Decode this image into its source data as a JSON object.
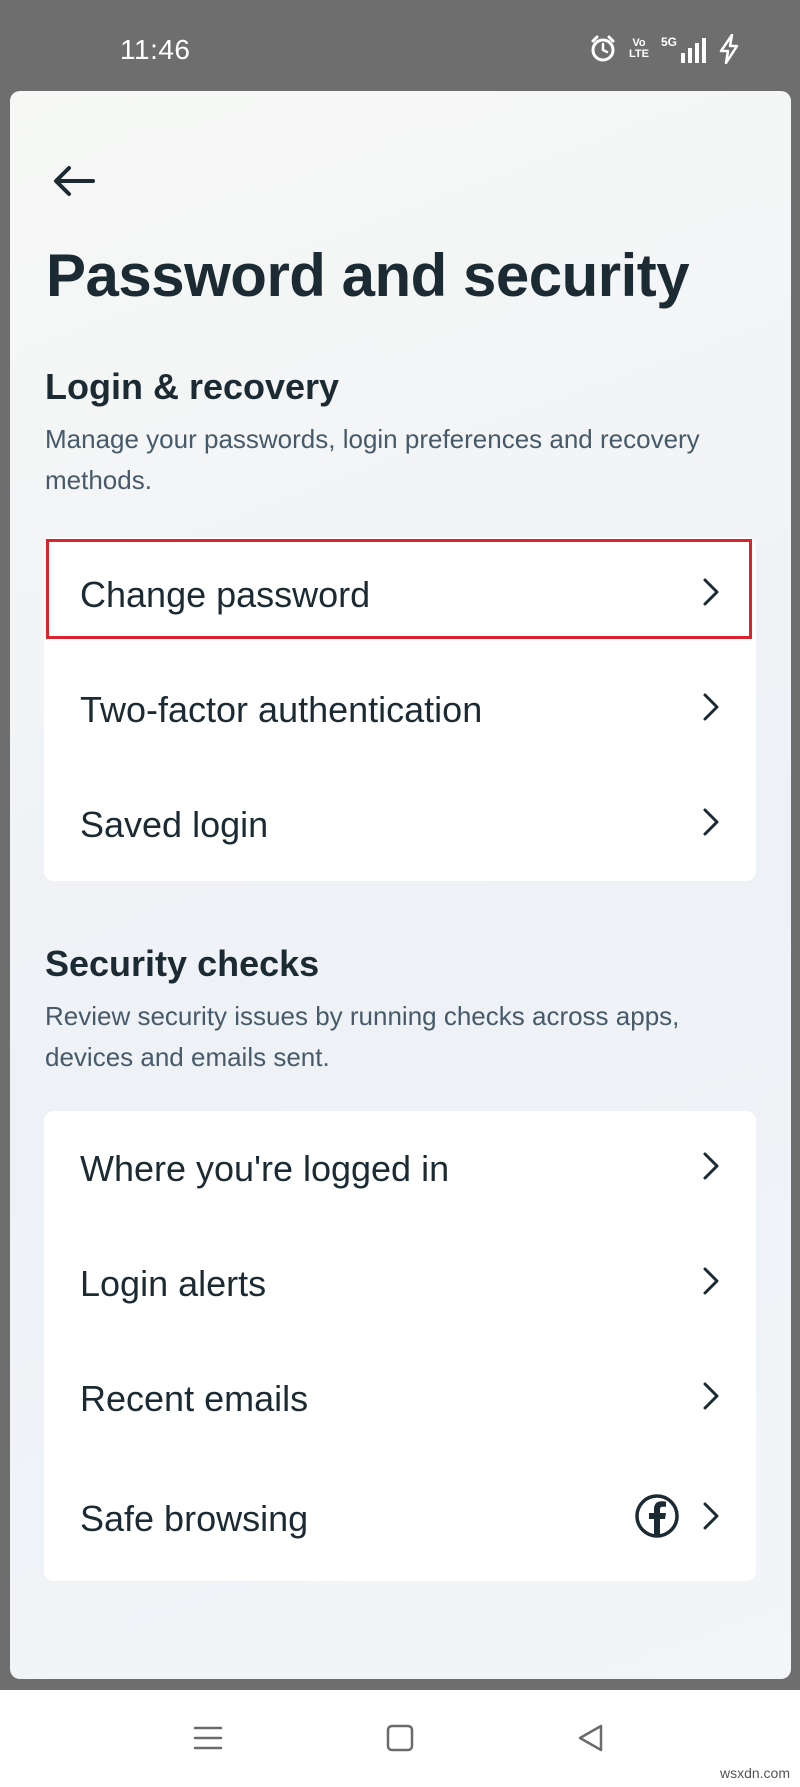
{
  "status_bar": {
    "time": "11:46",
    "volte_top": "Vo",
    "volte_bottom": "LTE",
    "network": "5G",
    "icons": [
      "alarm-icon",
      "volte-icon",
      "signal-icon",
      "charging-icon"
    ]
  },
  "header": {
    "back_icon": "arrow-left-icon",
    "title": "Password and security"
  },
  "login_recovery": {
    "title": "Login & recovery",
    "description": "Manage your passwords, login preferences and recovery methods.",
    "items": [
      {
        "label": "Change password",
        "highlighted": true
      },
      {
        "label": "Two-factor authentication"
      },
      {
        "label": "Saved login"
      }
    ]
  },
  "security_checks": {
    "title": "Security checks",
    "description": "Review security issues by running checks across apps, devices and emails sent.",
    "items": [
      {
        "label": "Where you're logged in"
      },
      {
        "label": "Login alerts"
      },
      {
        "label": "Recent emails"
      },
      {
        "label": "Safe browsing",
        "badge_icon": "facebook-icon"
      }
    ]
  },
  "nav_bar": {
    "icons": [
      "menu-icon",
      "home-square-icon",
      "back-triangle-icon"
    ]
  },
  "watermark": "wsxdn.com",
  "colors": {
    "highlight": "#d9232d",
    "text_primary": "#1c2b33",
    "text_secondary": "#465a69"
  }
}
